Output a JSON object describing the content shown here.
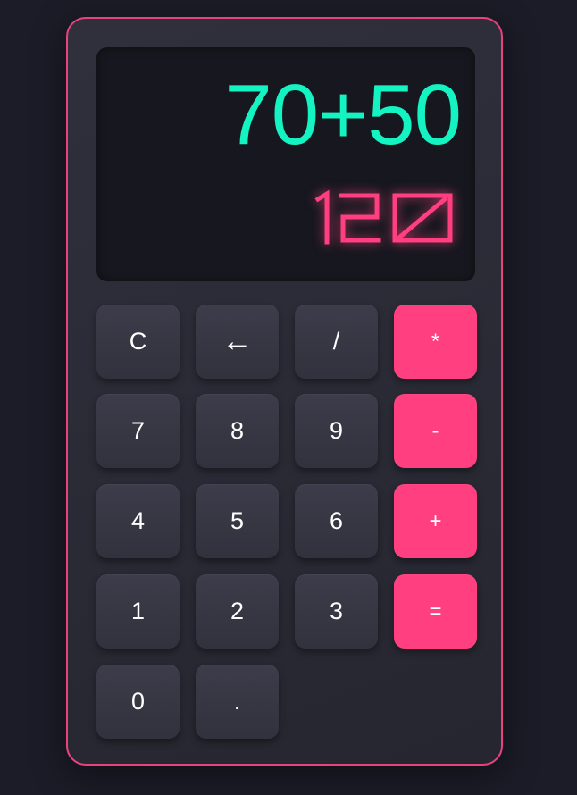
{
  "display": {
    "expression": "70+50",
    "result": "120",
    "colors": {
      "expression": "#14f4c2",
      "result": "#ff3f7f"
    }
  },
  "keys": {
    "clear": "C",
    "backspace": "←",
    "divide": "/",
    "multiply": "*",
    "seven": "7",
    "eight": "8",
    "nine": "9",
    "subtract": "-",
    "four": "4",
    "five": "5",
    "six": "6",
    "add": "+",
    "one": "1",
    "two": "2",
    "three": "3",
    "equals": "=",
    "zero": "0",
    "decimal": "."
  },
  "colors": {
    "background": "#1c1c28",
    "body_border": "#e8437f",
    "operator_key": "#ff3f7f",
    "number_key": "#383845"
  }
}
